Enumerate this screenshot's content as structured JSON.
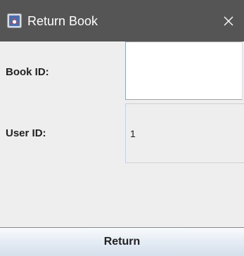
{
  "window": {
    "title": "Return Book",
    "icon": "java-cup-icon",
    "close_symbol": "✕"
  },
  "form": {
    "book_id_label": "Book ID:",
    "book_id_value": "",
    "user_id_label": "User ID:",
    "user_id_value": "1"
  },
  "actions": {
    "return_label": "Return"
  },
  "colors": {
    "titlebar": "#555555",
    "background": "#eeeeee",
    "button_top": "#f9fbfd",
    "button_bottom": "#d5e0ec",
    "field_border": "#8fa5c4"
  }
}
